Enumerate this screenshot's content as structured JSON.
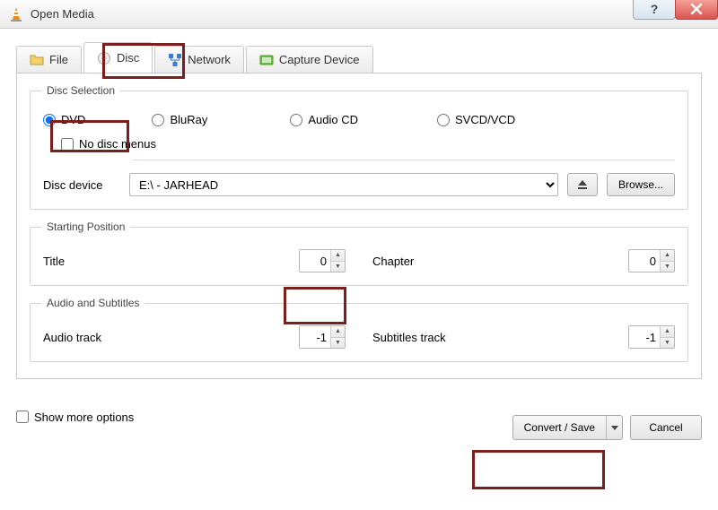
{
  "window": {
    "title": "Open Media"
  },
  "tabs": {
    "file": "File",
    "disc": "Disc",
    "network": "Network",
    "capture": "Capture Device"
  },
  "disc_selection": {
    "legend": "Disc Selection",
    "dvd": "DVD",
    "bluray": "BluRay",
    "audiocd": "Audio CD",
    "svcd": "SVCD/VCD",
    "no_menus": "No disc menus",
    "disc_device_label": "Disc device",
    "disc_device_value": "E:\\ - JARHEAD",
    "browse": "Browse..."
  },
  "starting_position": {
    "legend": "Starting Position",
    "title_label": "Title",
    "title_value": "0",
    "chapter_label": "Chapter",
    "chapter_value": "0"
  },
  "audio_subtitles": {
    "legend": "Audio and Subtitles",
    "audio_track_label": "Audio track",
    "audio_track_value": "-1",
    "subtitles_track_label": "Subtitles track",
    "subtitles_track_value": "-1"
  },
  "footer": {
    "show_more": "Show more options",
    "convert_save": "Convert / Save",
    "cancel": "Cancel"
  }
}
